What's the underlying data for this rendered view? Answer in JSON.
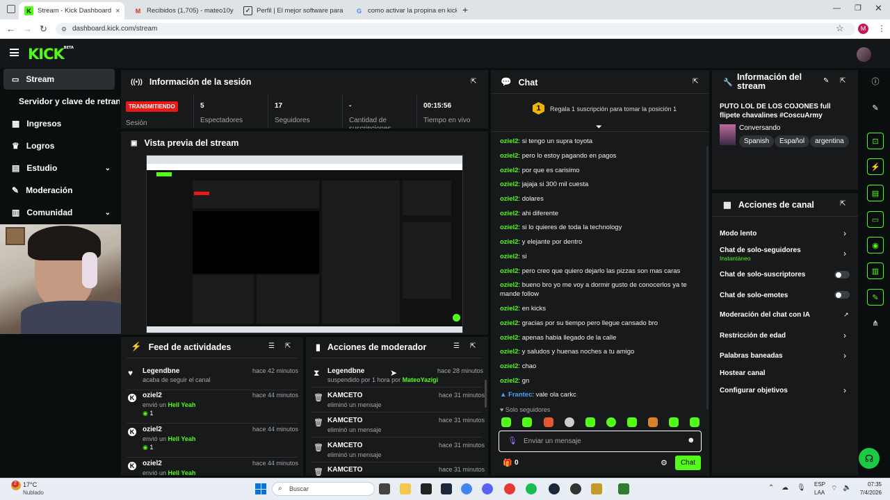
{
  "browser": {
    "tabs": [
      {
        "title": "Stream - Kick Dashboard"
      },
      {
        "title": "Recibidos (1,705) - mateo10ya"
      },
      {
        "title": "Perfil | El mejor software para p"
      },
      {
        "title": "como activar la propina en kick"
      }
    ],
    "url": "dashboard.kick.com/stream",
    "profile_initial": "M"
  },
  "brand": {
    "logo": "KICK",
    "beta": "BETA",
    "accent": "#53fc18"
  },
  "sidebar": {
    "items": [
      {
        "label": "Stream"
      },
      {
        "label": "Servidor y clave de retransmisión"
      },
      {
        "label": "Ingresos"
      },
      {
        "label": "Logros"
      },
      {
        "label": "Estudio"
      },
      {
        "label": "Moderación"
      },
      {
        "label": "Comunidad"
      }
    ]
  },
  "session": {
    "title": "Información de la sesión",
    "status_badge": "TRANSMITIENDO",
    "status_label": "Sesión",
    "stats": [
      {
        "value": "5",
        "label": "Espectadores"
      },
      {
        "value": "17",
        "label": "Seguidores"
      },
      {
        "value": "-",
        "label": "Cantidad de suscripciones"
      },
      {
        "value": "00:15:56",
        "label": "Tiempo en vivo"
      }
    ]
  },
  "preview": {
    "title": "Vista previa del stream"
  },
  "feed": {
    "title": "Feed de actividades",
    "items": [
      {
        "user": "Legendbne",
        "action": "acaba de seguir el canal",
        "time": "hace 42 minutos"
      },
      {
        "user": "oziel2",
        "action": "envió un",
        "item": "Hell Yeah",
        "count": "1",
        "time": "hace 44 minutos"
      },
      {
        "user": "oziel2",
        "action": "envió un",
        "item": "Hell Yeah",
        "count": "1",
        "time": "hace 44 minutos"
      },
      {
        "user": "oziel2",
        "action": "envió un",
        "item": "Hell Yeah",
        "time": "hace 44 minutos"
      }
    ]
  },
  "modactions": {
    "title": "Acciones de moderador",
    "items": [
      {
        "user": "Legendbne",
        "action": "suspendido por 1 hora por",
        "by": "MateoYazigi",
        "time": "hace 28 minutos"
      },
      {
        "user": "KAMCETO",
        "action": "eliminó un mensaje",
        "time": "hace 31 minutos"
      },
      {
        "user": "KAMCETO",
        "action": "eliminó un mensaje",
        "time": "hace 31 minutos"
      },
      {
        "user": "KAMCETO",
        "action": "eliminó un mensaje",
        "time": "hace 31 minutos"
      },
      {
        "user": "KAMCETO",
        "action": "",
        "time": "hace 31 minutos"
      }
    ]
  },
  "chat": {
    "title": "Chat",
    "sub_promo": "Regala 1 suscripción para tomar la posición 1",
    "sub_rank": "1",
    "messages": [
      {
        "user": "oziel2",
        "text": "si tengo un supra toyota"
      },
      {
        "user": "oziel2",
        "text": "pero lo estoy pagando en pagos"
      },
      {
        "user": "oziel2",
        "text": "por que es carisimo"
      },
      {
        "user": "oziel2",
        "text": "jajaja si 300 mil cuesta"
      },
      {
        "user": "oziel2",
        "text": "dolares"
      },
      {
        "user": "oziel2",
        "text": "ahi diferente"
      },
      {
        "user": "oziel2",
        "text": "si lo quieres de toda la technology"
      },
      {
        "user": "oziel2",
        "text": "y elejante por dentro"
      },
      {
        "user": "oziel2",
        "text": "si"
      },
      {
        "user": "oziel2",
        "text": "pero creo que quiero dejarlo las pizzas son mas caras"
      },
      {
        "user": "oziel2",
        "text": "bueno bro yo me voy a dormir gusto de conocerlos ya te mande follow"
      },
      {
        "user": "oziel2",
        "text": "en kicks"
      },
      {
        "user": "oziel2",
        "text": "gracias por su tiempo pero llegue cansado bro"
      },
      {
        "user": "oziel2",
        "text": "apenas habia llegado de la calle"
      },
      {
        "user": "oziel2",
        "text": "y saludos y huenas noches a tu amigo"
      },
      {
        "user": "oziel2",
        "text": "chao"
      },
      {
        "user": "oziel2",
        "text": "gn"
      },
      {
        "user": "Frantec",
        "text": "vale ola carkc"
      }
    ],
    "mode_label": "Solo seguidores",
    "input_placeholder": "Enviar un mensaje",
    "gift_count": "0",
    "send_label": "Chat"
  },
  "stream_info": {
    "title": "Información del stream",
    "stream_title": "PUTO LOL DE LOS COJONES full flipete chavalines #CoscuArmy",
    "category": "Conversando",
    "tags": [
      "Spanish",
      "Español",
      "argentina"
    ]
  },
  "channel_actions": {
    "title": "Acciones de canal",
    "items": [
      {
        "label": "Modo lento",
        "control": "arrow"
      },
      {
        "label": "Chat de solo-seguidores",
        "sub": "Instantáneo",
        "control": "arrow"
      },
      {
        "label": "Chat de solo-suscriptores",
        "control": "toggle"
      },
      {
        "label": "Chat de solo-emotes",
        "control": "toggle"
      },
      {
        "label": "Moderación del chat con IA",
        "control": "external"
      },
      {
        "label": "Restricción de edad",
        "control": "arrow"
      },
      {
        "label": "Palabras baneadas",
        "control": "arrow"
      },
      {
        "label": "Hostear canal",
        "control": "none"
      },
      {
        "label": "Configurar objetivos",
        "control": "arrow"
      }
    ]
  },
  "taskbar": {
    "weather_temp": "17°C",
    "weather_desc": "Nublado",
    "weather_badge": "2",
    "search_placeholder": "Buscar",
    "lang": "ESP",
    "lang2": "LAA",
    "time": "07:35",
    "date": "7/4/2026"
  }
}
